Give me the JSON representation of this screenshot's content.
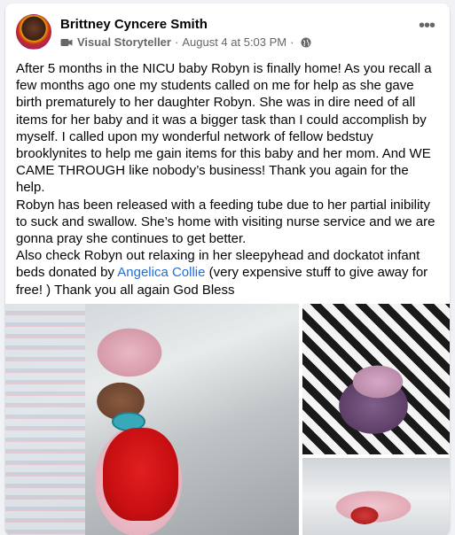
{
  "post": {
    "author": "Brittney Cyncere Smith",
    "role": "Visual Storyteller",
    "separator": "·",
    "date": "August 4 at 5:03 PM",
    "separator2": "·",
    "more_label": "•••",
    "icons": {
      "avatar": "profile-avatar",
      "role_badge": "storyteller-badge-icon",
      "audience": "globe-icon",
      "more": "more-options-icon"
    },
    "paragraph1": "After 5 months in the NICU baby Robyn is finally home!  As you recall a few months ago one my students called on me for help as she gave birth prematurely to her daughter Robyn.  She was in dire need of all items for her baby and it was a bigger task than I could accomplish by myself.  I called upon my wonderful network of fellow bedstuy brooklynites to help me gain items for this baby and her mom. And WE CAME THROUGH like nobody’s business! Thank you again for the help.",
    "paragraph2": "Robyn has been released with a feeding tube due to her partial inibility to suck and swallow.  She’s home with visiting nurse service and we are gonna pray she continues to get better.",
    "paragraph3_before": "Also check Robyn out relaxing in her sleepyhead and dockatot infant beds donated by ",
    "paragraph3_link": "Angelica Collie",
    "paragraph3_after": " (very expensive stuff to give away for free! ) Thank you all again God Bless",
    "link_color": "#216fdb"
  },
  "photos": [
    {
      "name": "baby-in-pink-with-red-toy"
    },
    {
      "name": "baby-in-patterned-bed"
    },
    {
      "name": "baby-in-infant-bed"
    }
  ]
}
